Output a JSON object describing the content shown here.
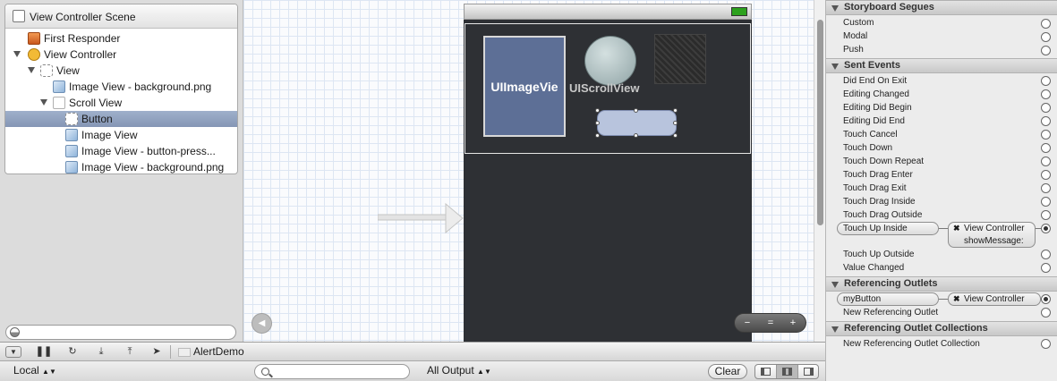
{
  "outline": {
    "scene_title": "View Controller Scene",
    "items": [
      {
        "label": "First Responder"
      },
      {
        "label": "View Controller"
      },
      {
        "label": "View"
      },
      {
        "label": "Image View - background.png"
      },
      {
        "label": "Scroll View"
      },
      {
        "label": "Button"
      },
      {
        "label": "Image View"
      },
      {
        "label": "Image View - button-press..."
      },
      {
        "label": "Image View - background.png"
      }
    ]
  },
  "canvas": {
    "imageview_label": "UIImageVie",
    "scrollview_label": "UIScrollView",
    "zoom_out": "−",
    "zoom_reset": "=",
    "zoom_in": "+"
  },
  "debug": {
    "target": "AlertDemo"
  },
  "output": {
    "scope": "Local",
    "filter": "All Output",
    "clear": "Clear"
  },
  "connections": {
    "segues_title": "Storyboard Segues",
    "segues": [
      "Custom",
      "Modal",
      "Push"
    ],
    "events_title": "Sent Events",
    "events": [
      "Did End On Exit",
      "Editing Changed",
      "Editing Did Begin",
      "Editing Did End",
      "Touch Cancel",
      "Touch Down",
      "Touch Down Repeat",
      "Touch Drag Enter",
      "Touch Drag Exit",
      "Touch Drag Inside",
      "Touch Drag Outside"
    ],
    "touch_up_inside": "Touch Up Inside",
    "touch_up_target": "View Controller",
    "touch_up_action": "showMessage:",
    "events_after": [
      "Touch Up Outside",
      "Value Changed"
    ],
    "outlets_title": "Referencing Outlets",
    "outlet_name": "myButton",
    "outlet_target": "View Controller",
    "new_outlet": "New Referencing Outlet",
    "collections_title": "Referencing Outlet Collections",
    "new_collection": "New Referencing Outlet Collection"
  }
}
